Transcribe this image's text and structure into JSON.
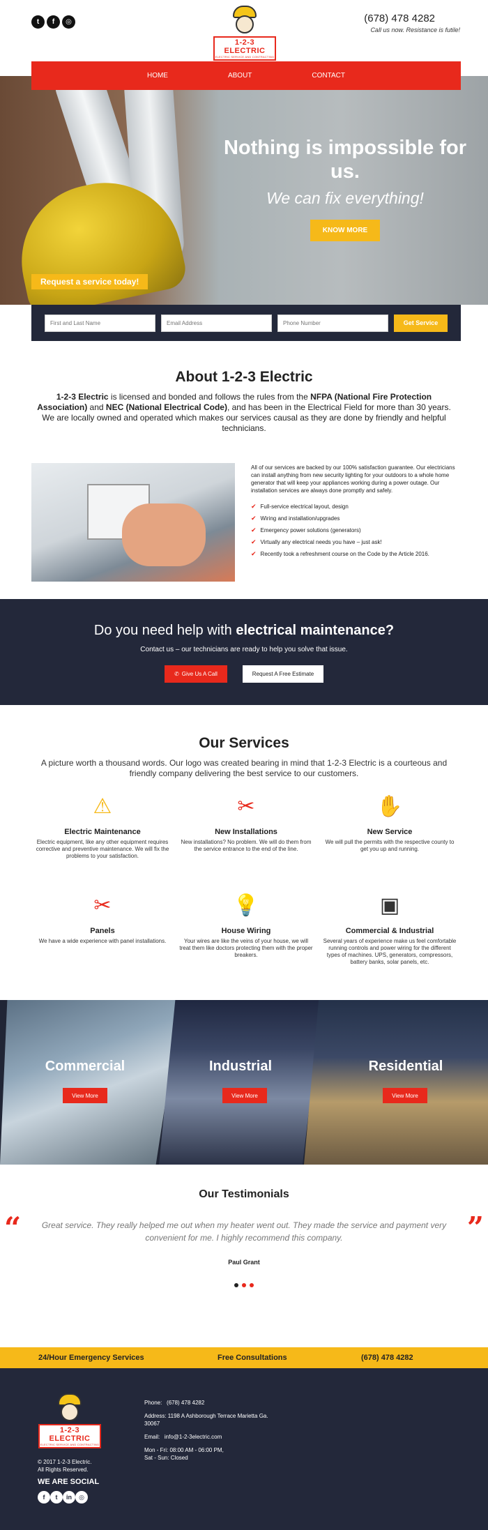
{
  "header": {
    "social": [
      "t",
      "f",
      "◎"
    ],
    "logo": {
      "name": "1-2-3 ELECTRIC",
      "tagline": "ELECTRIC SERVICE AND CONTRACTING"
    },
    "phone": "(678) 478 4282",
    "phone_sub": "Call us now. Resistance is futile!"
  },
  "nav": {
    "items": [
      "HOME",
      "ABOUT",
      "CONTACT"
    ]
  },
  "hero": {
    "title": "Nothing is impossible for us.",
    "subtitle": "We can fix everything!",
    "button": "KNOW MORE"
  },
  "request": {
    "tab": "Request a service today!",
    "name_placeholder": "First and Last Name",
    "email_placeholder": "Email Address",
    "phone_placeholder": "Phone Number",
    "button": "Get Service"
  },
  "about": {
    "title": "About 1-2-3 Electric",
    "p1_strong1": "1-2-3 Electric",
    "p1_a": " is licensed and bonded and follows the rules from the ",
    "p1_strong2": "NFPA (National Fire Protection Association)",
    "p1_b": " and ",
    "p1_strong3": "NEC (National Electrical Code)",
    "p1_c": ", and has been in the Electrical Field for more than 30 years. We are locally owned and operated which makes our services causal as they are done by friendly and helpful technicians.",
    "right_text": "All of our services are backed by our 100% satisfaction guarantee. Our electricians can install anything from new security lighting for your outdoors to a whole home generator that will keep your appliances working during a power outage. Our installation services are always done promptly and safely.",
    "list": [
      "Full-service electrical layout, design",
      "Wiring and installation/upgrades",
      "Emergency power solutions (generators)",
      "Virtually any electrical needs you have – just ask!",
      "Recently took a refreshment course on the Code by the Article 2016."
    ]
  },
  "cta": {
    "title_a": "Do you need help with ",
    "title_b": "electrical maintenance?",
    "sub": "Contact us – our technicians are ready to help you solve that issue.",
    "call_btn": "Give Us A Call",
    "estimate_btn": "Request A Free Estimate"
  },
  "services": {
    "title": "Our Services",
    "intro": "A picture worth a thousand words. Our logo was created bearing in mind that 1-2-3 Electric is a courteous and friendly company delivering the best service to our customers.",
    "items": [
      {
        "icon": "⚠",
        "color": "#f6b919",
        "name": "Electric Maintenance",
        "desc": "Electric equipment, like any other equipment requires corrective and preventive maintenance. We will fix the problems to your satisfaction."
      },
      {
        "icon": "✂",
        "color": "#e8291c",
        "name": "New Installations",
        "desc": "New installations? No problem. We will do them from the service entrance to the end of the line."
      },
      {
        "icon": "✋",
        "color": "#f39a1c",
        "name": "New Service",
        "desc": "We will pull the permits with the respective county to get you up and running."
      },
      {
        "icon": "✂",
        "color": "#e8291c",
        "name": "Panels",
        "desc": "We have a wide experience with panel installations."
      },
      {
        "icon": "💡",
        "color": "#f6b919",
        "name": "House Wiring",
        "desc": "Your wires are like the veins of your house, we will treat them like doctors protecting them with the proper breakers."
      },
      {
        "icon": "▣",
        "color": "#333333",
        "name": "Commercial & Industrial",
        "desc": "Several years of experience make us feel comfortable running controls and power wiring for the different types of machines. UPS, generators, compressors, battery banks, solar panels, etc."
      }
    ]
  },
  "categories": {
    "items": [
      {
        "title": "Commercial",
        "button": "View More"
      },
      {
        "title": "Industrial",
        "button": "View More"
      },
      {
        "title": "Residential",
        "button": "View More"
      }
    ]
  },
  "testimonials": {
    "title": "Our Testimonials",
    "quote": "Great service. They really helped me out when my heater went out. They made the service and payment very convenient for me. I highly recommend this company.",
    "author": "Paul Grant",
    "open_quote": "“",
    "close_quote": "”"
  },
  "banner": {
    "item1": "24/Hour Emergency Services",
    "item2": "Free Consultations",
    "item3": "(678) 478 4282"
  },
  "footer": {
    "copyright_1": "© 2017 1-2-3 Electric.",
    "copyright_2": "All Rights Reserved.",
    "social_title": "WE ARE SOCIAL",
    "social": [
      "f",
      "t",
      "in",
      "◎"
    ],
    "phone_label": "Phone:",
    "phone": "(678) 478 4282",
    "address": "Address: 1198 A Ashborough Terrace Marietta Ga. 30067",
    "email_label": "Email:",
    "email": "info@1-2-3electric.com",
    "hours_1": "Mon - Fri: 08:00 AM - 06:00 PM,",
    "hours_2": "Sat - Sun: Closed"
  }
}
